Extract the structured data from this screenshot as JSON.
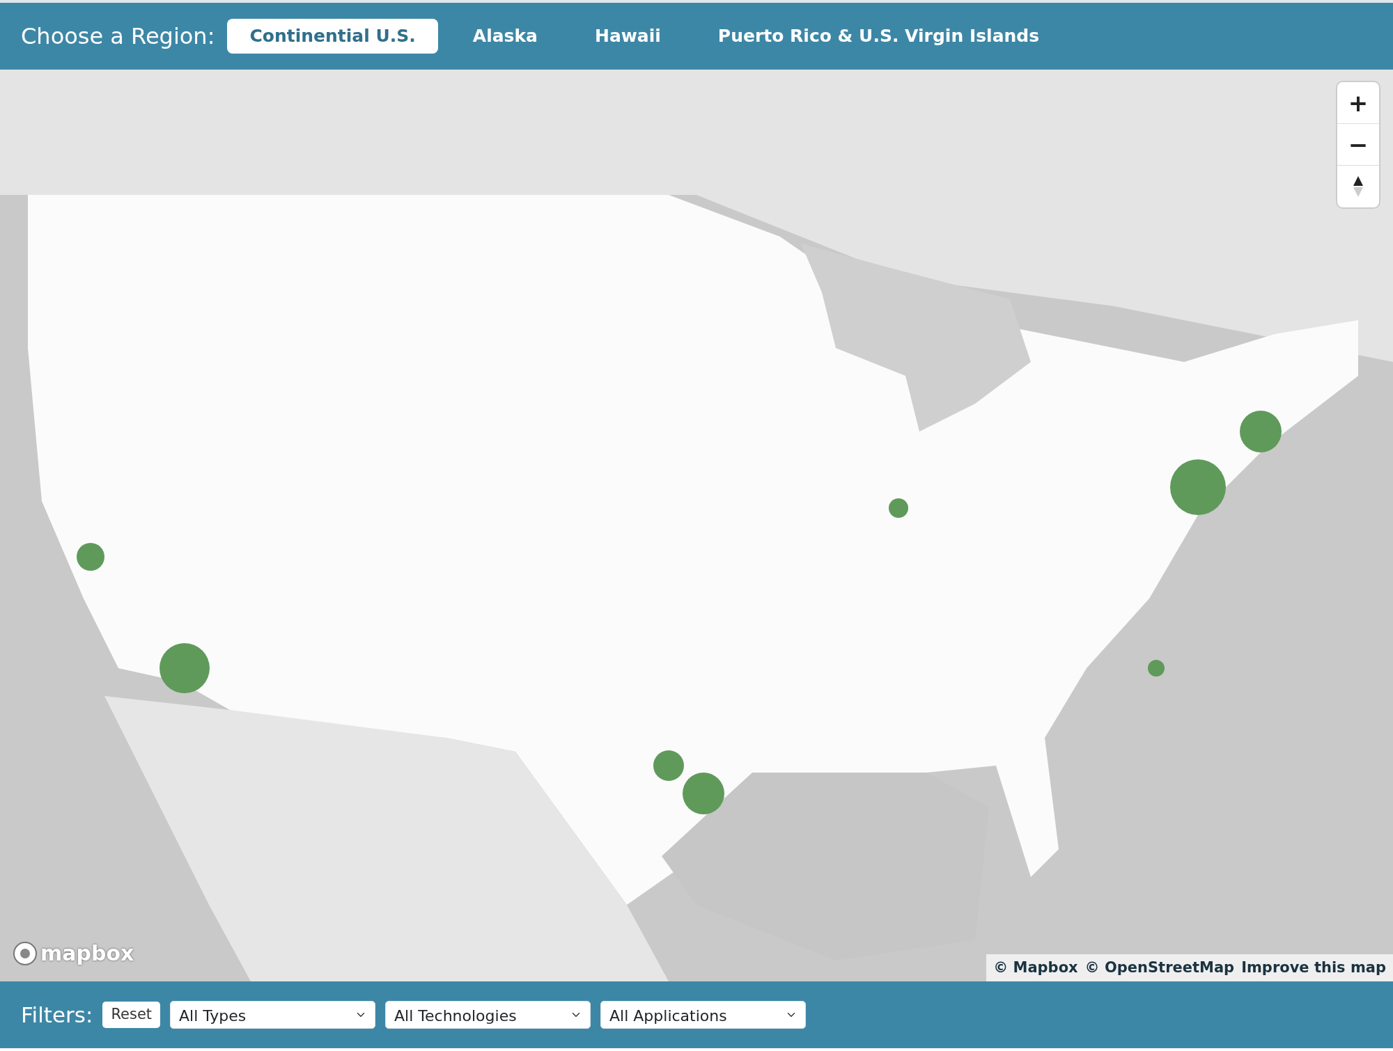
{
  "region_bar": {
    "label": "Choose a Region:",
    "tabs": [
      {
        "label": "Continential U.S.",
        "selected": true
      },
      {
        "label": "Alaska",
        "selected": false
      },
      {
        "label": "Hawaii",
        "selected": false
      },
      {
        "label": "Puerto Rico & U.S. Virgin Islands",
        "selected": false
      }
    ]
  },
  "map": {
    "controls": [
      "+",
      "−"
    ],
    "logo": "mapbox",
    "attribution": [
      "© Mapbox",
      "© OpenStreetMap",
      "Improve this map"
    ]
  },
  "filters": {
    "label": "Filters:",
    "reset": "Reset",
    "selects": [
      "All Types",
      "All Technologies",
      "All Applications"
    ]
  }
}
